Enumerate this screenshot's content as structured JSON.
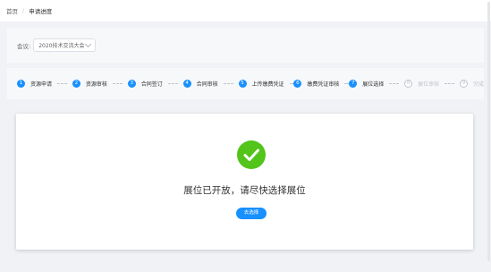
{
  "breadcrumb": {
    "home": "首页",
    "separator": "/",
    "current": "申请进度"
  },
  "filter": {
    "label": "会议:",
    "value": "2020技术交流大会"
  },
  "steps": [
    {
      "num": "1",
      "label": "资源申请",
      "status": "finish"
    },
    {
      "num": "2",
      "label": "资源审核",
      "status": "finish"
    },
    {
      "num": "3",
      "label": "合同签订",
      "status": "finish"
    },
    {
      "num": "4",
      "label": "合同审核",
      "status": "finish"
    },
    {
      "num": "5",
      "label": "上传缴费凭证",
      "status": "finish"
    },
    {
      "num": "6",
      "label": "缴费凭证审核",
      "status": "finish"
    },
    {
      "num": "7",
      "label": "展位选择",
      "status": "process"
    },
    {
      "num": "8",
      "label": "展位审核",
      "status": "wait"
    },
    {
      "num": "9",
      "label": "完成",
      "status": "wait"
    }
  ],
  "result": {
    "icon": "check-circle-icon",
    "title": "展位已开放，请尽快选择展位",
    "button_label": "去选择"
  },
  "colors": {
    "primary": "#1890ff",
    "success": "#52c41a",
    "wait": "#c0c4cc"
  }
}
